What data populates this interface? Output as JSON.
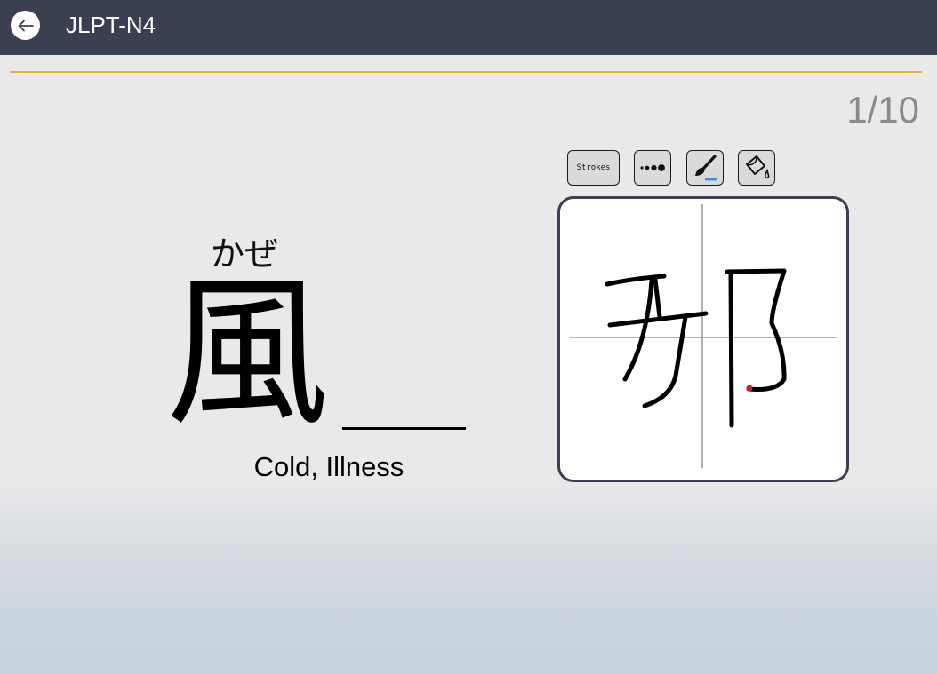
{
  "header": {
    "title": "JLPT-N4"
  },
  "progress": {
    "counter": "1/10"
  },
  "card": {
    "furigana": "かぜ",
    "kanji": "風",
    "meaning": "Cold, Illness"
  },
  "toolbar": {
    "strokes_label": "Strokes"
  },
  "colors": {
    "header_bg": "#3a3f52",
    "accent_line": "#e6b33f",
    "brush_underline": "#3b8fd6",
    "stroke_end_dot": "#d32020"
  }
}
